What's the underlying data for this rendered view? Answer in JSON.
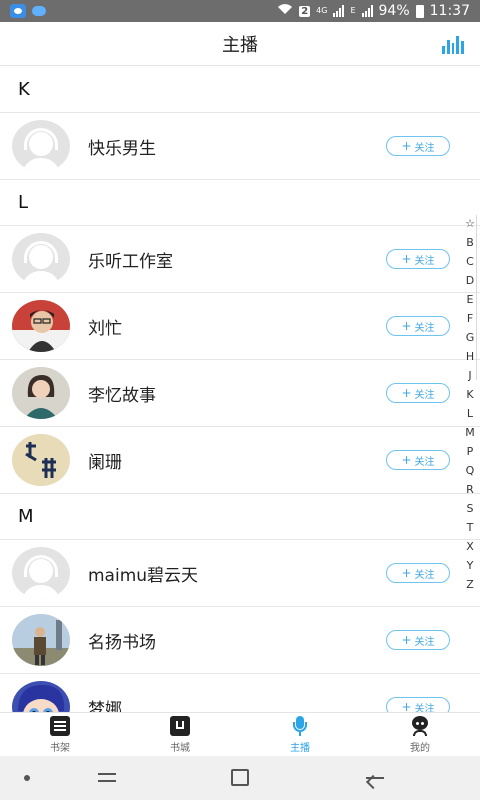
{
  "status_bar": {
    "network_small": "4G",
    "network_small2": "4G",
    "sim_badge": "2",
    "data_letter": "E",
    "battery": "94%",
    "time": "11:37"
  },
  "header": {
    "title": "主播",
    "right_icon": "bar-chart-icon"
  },
  "list": {
    "sections": [
      {
        "letter": "K",
        "items": [
          {
            "name": "快乐男生",
            "avatar": "default-headphone-avatar",
            "follow_label": "关注"
          }
        ]
      },
      {
        "letter": "L",
        "items": [
          {
            "name": "乐听工作室",
            "avatar": "default-headphone-avatar",
            "follow_label": "关注"
          },
          {
            "name": "刘忙",
            "avatar": "photo-man-glasses",
            "follow_label": "关注"
          },
          {
            "name": "李忆故事",
            "avatar": "photo-woman",
            "follow_label": "关注"
          },
          {
            "name": "阑珊",
            "avatar": "photo-calligraphy",
            "follow_label": "关注"
          }
        ]
      },
      {
        "letter": "M",
        "items": [
          {
            "name": "maimu碧云天",
            "avatar": "default-headphone-avatar",
            "follow_label": "关注"
          },
          {
            "name": "名扬书场",
            "avatar": "photo-person-outdoor",
            "follow_label": "关注"
          },
          {
            "name": "梦娜",
            "avatar": "photo-anime-girl",
            "follow_label": "关注"
          }
        ]
      }
    ]
  },
  "alpha_index": [
    "☆",
    "B",
    "C",
    "D",
    "E",
    "F",
    "G",
    "H",
    "J",
    "K",
    "L",
    "M",
    "P",
    "Q",
    "R",
    "S",
    "T",
    "X",
    "Y",
    "Z"
  ],
  "tabbar": {
    "tabs": [
      {
        "label": "书架",
        "icon": "bookshelf-icon",
        "active": false
      },
      {
        "label": "书城",
        "icon": "bookstore-icon",
        "active": false
      },
      {
        "label": "主播",
        "icon": "microphone-icon",
        "active": true
      },
      {
        "label": "我的",
        "icon": "profile-icon",
        "active": false
      }
    ]
  },
  "colors": {
    "accent": "#2ba5e8",
    "follow_border": "#6ec3ef",
    "divider": "#e6e6e6"
  }
}
